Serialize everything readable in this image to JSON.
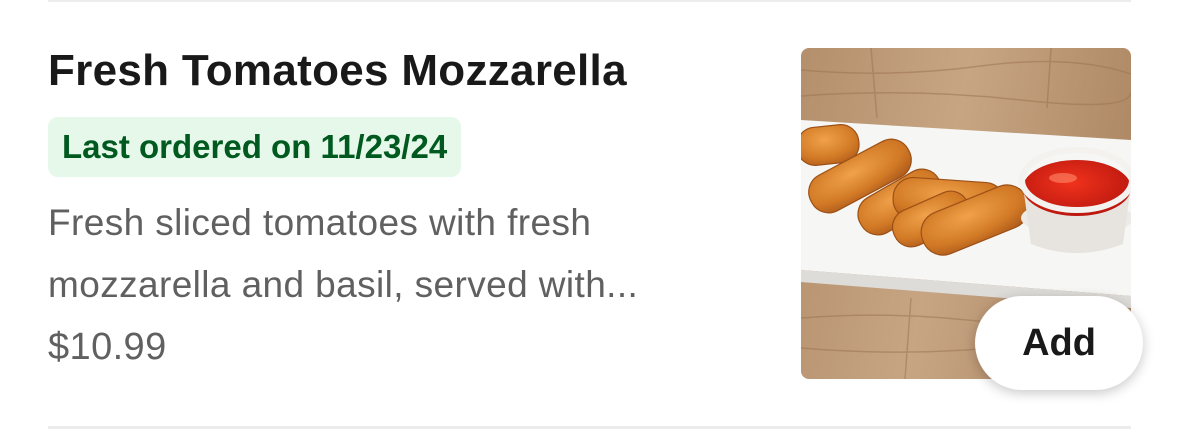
{
  "item": {
    "title": "Fresh Tomatoes Mozzarella",
    "badge": "Last ordered on 11/23/24",
    "description_line1": "Fresh sliced tomatoes with fresh",
    "description_line2": "mozzarella and basil, served with...",
    "price": "$10.99",
    "image_icon": "food-photo-mozzarella-sticks",
    "add_label": "Add"
  },
  "colors": {
    "badge_background": "#e5f8ea",
    "badge_text": "#00591e",
    "title_text": "#191919",
    "secondary_text": "#606060"
  }
}
